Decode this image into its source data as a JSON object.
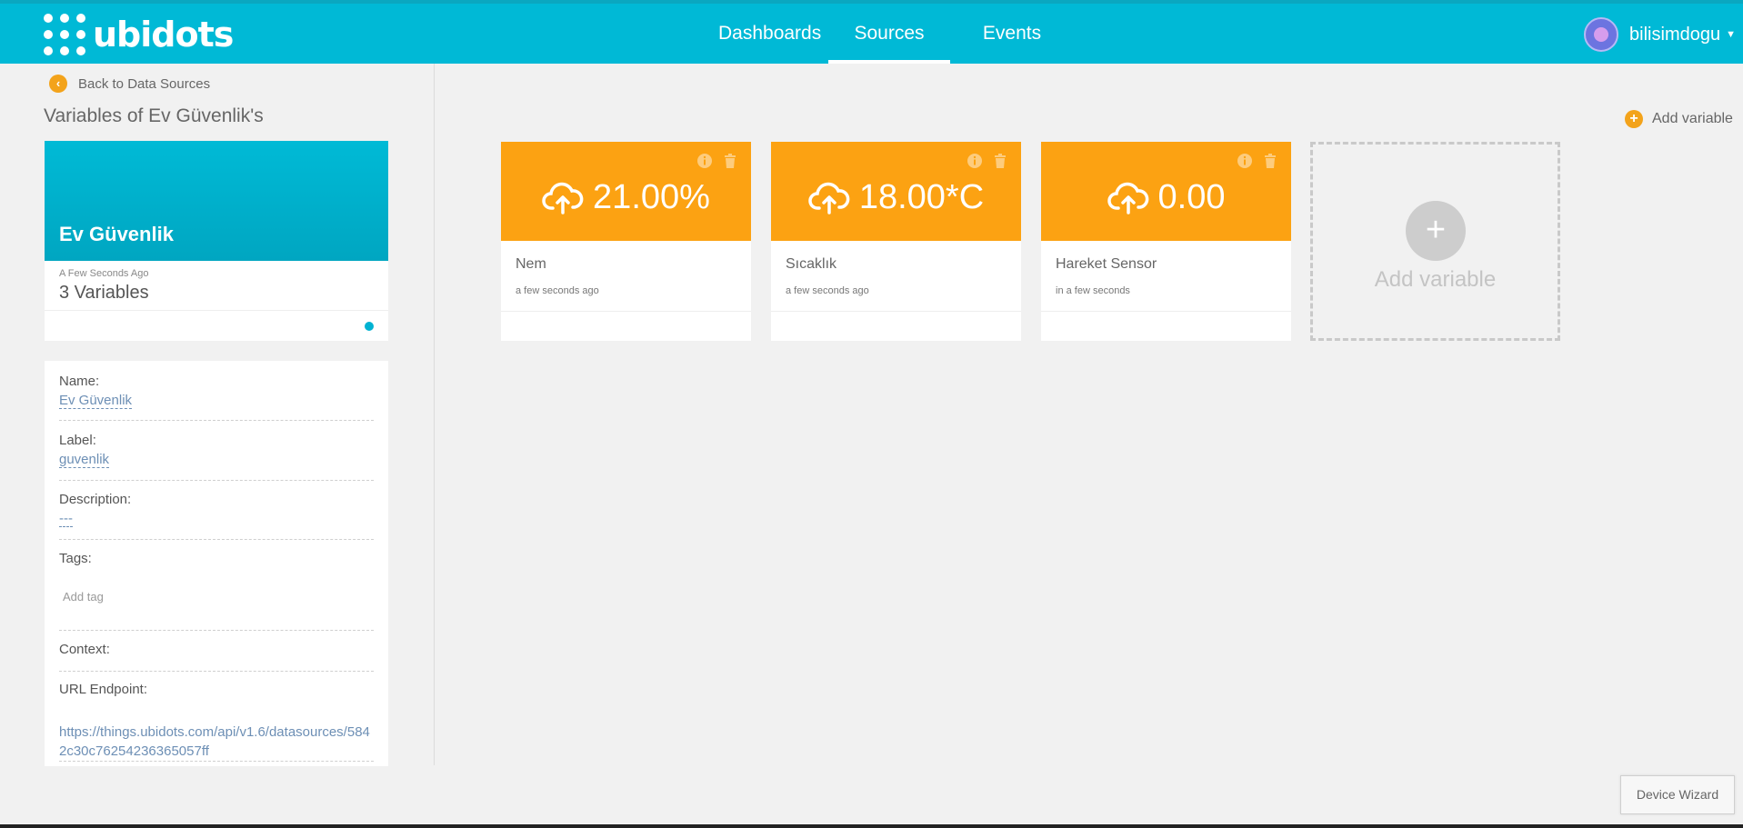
{
  "brand": {
    "name": "ubidots"
  },
  "nav": {
    "items": [
      {
        "label": "Dashboards"
      },
      {
        "label": "Sources"
      },
      {
        "label": "Events"
      }
    ]
  },
  "user": {
    "name": "bilisimdogu"
  },
  "sidebar": {
    "back_label": "Back to Data Sources",
    "page_title": "Variables of Ev Güvenlik's",
    "device": {
      "name": "Ev Güvenlik",
      "timestamp": "A Few Seconds Ago",
      "variable_count": "3 Variables"
    },
    "props": {
      "name_label": "Name:",
      "name_value": "Ev Güvenlik",
      "label_label": "Label:",
      "label_value": "guvenlik",
      "description_label": "Description:",
      "description_value": "---",
      "tags_label": "Tags:",
      "tags_placeholder": "Add tag",
      "context_label": "Context:",
      "url_label": "URL Endpoint:",
      "url_value": "https://things.ubidots.com/api/v1.6/datasources/5842c30c76254236365057ff"
    }
  },
  "main": {
    "add_variable_label": "Add variable",
    "variables": [
      {
        "value": "21.00%",
        "name": "Nem",
        "timestamp": "a few seconds ago"
      },
      {
        "value": "18.00*C",
        "name": "Sıcaklık",
        "timestamp": "a few seconds ago"
      },
      {
        "value": "0.00",
        "name": "Hareket Sensor",
        "timestamp": "in a few seconds"
      }
    ],
    "add_card_label": "Add variable"
  },
  "footer": {
    "wizard_label": "Device Wizard"
  },
  "colors": {
    "navbar": "#00b9d6",
    "variable_card": "#fca212",
    "accent": "#f3a31b"
  }
}
